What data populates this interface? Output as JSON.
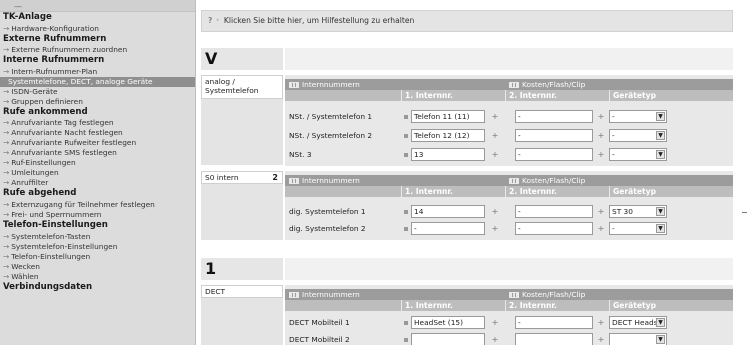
{
  "sidebar": {
    "dash": "—",
    "sections": [
      {
        "title": "TK-Anlage",
        "items": [
          {
            "label": "Hardware-Konfiguration"
          }
        ]
      },
      {
        "title": "Externe Rufnummern",
        "items": [
          {
            "label": "Externe Rufnummern zuordnen"
          }
        ]
      },
      {
        "title": "Interne Rufnummern",
        "items": [
          {
            "label": "Intern-Rufnummer-Plan"
          },
          {
            "label": "Systemtelefone, DECT, analoge Geräte",
            "active": true
          },
          {
            "label": "ISDN-Geräte"
          },
          {
            "label": "Gruppen definieren"
          }
        ]
      },
      {
        "title": "Rufe ankommend",
        "items": [
          {
            "label": "Anrufvariante Tag festlegen"
          },
          {
            "label": "Anrufvariante Nacht festlegen"
          },
          {
            "label": "Anrufvariante Rufweiter festlegen"
          },
          {
            "label": "Anrufvariante SMS festlegen"
          },
          {
            "label": "Ruf-Einstellungen"
          },
          {
            "label": "Umleitungen"
          },
          {
            "label": "Anruffilter"
          }
        ]
      },
      {
        "title": "Rufe abgehend",
        "items": [
          {
            "label": "Externzugang für Teilnehmer festlegen"
          },
          {
            "label": "Frei- und Sperrnummern"
          }
        ]
      },
      {
        "title": "Telefon-Einstellungen",
        "items": [
          {
            "label": "Systemtelefon-Tasten"
          },
          {
            "label": "Systemtelefon-Einstellungen"
          },
          {
            "label": "Telefon-Einstellungen"
          },
          {
            "label": "Wecken"
          },
          {
            "label": "Wählen"
          }
        ]
      },
      {
        "title": "Verbindungsdaten",
        "items": []
      }
    ]
  },
  "help": {
    "icon": "?",
    "text": "Klicken Sie bitte hier, um Hilfestellung zu erhalten"
  },
  "blocks": {
    "letter_v": "V",
    "letter_1": "1",
    "headers": {
      "internnummern": "Internnummern",
      "kosten": "Kosten/Flash/Clip",
      "col1": "1. Internnr.",
      "col2": "2. Internnr.",
      "col3": "Gerätetyp"
    },
    "analog": {
      "label": "analog / Systemtelefon",
      "rows": [
        {
          "label": "NSt. / Systemtelefon 1",
          "int1": "Telefon 11 (11)",
          "int2": "-",
          "type": "-"
        },
        {
          "label": "NSt. / Systemtelefon 2",
          "int1": "Telefon 12 (12)",
          "int2": "-",
          "type": "-"
        },
        {
          "label": "NSt. 3",
          "int1": "13",
          "int2": "-",
          "type": "-"
        }
      ]
    },
    "s0": {
      "label": "S0 intern",
      "num": "2",
      "rows": [
        {
          "label": "dig. Systemtelefon 1",
          "int1": "14",
          "int2": "-",
          "type": "ST 30"
        },
        {
          "label": "dig. Systemtelefon 2",
          "int1": "-",
          "int2": "-",
          "type": "-"
        }
      ]
    },
    "dect": {
      "label": "DECT",
      "rows": [
        {
          "label": "DECT Mobilteil 1",
          "int1": "HeadSet (15)",
          "int2": "-",
          "type": "DECT Headset"
        },
        {
          "label": "DECT Mobilteil 2",
          "int1": "",
          "int2": "",
          "type": ""
        }
      ]
    }
  },
  "symbols": {
    "plus": "+",
    "dropdown": "▼"
  }
}
